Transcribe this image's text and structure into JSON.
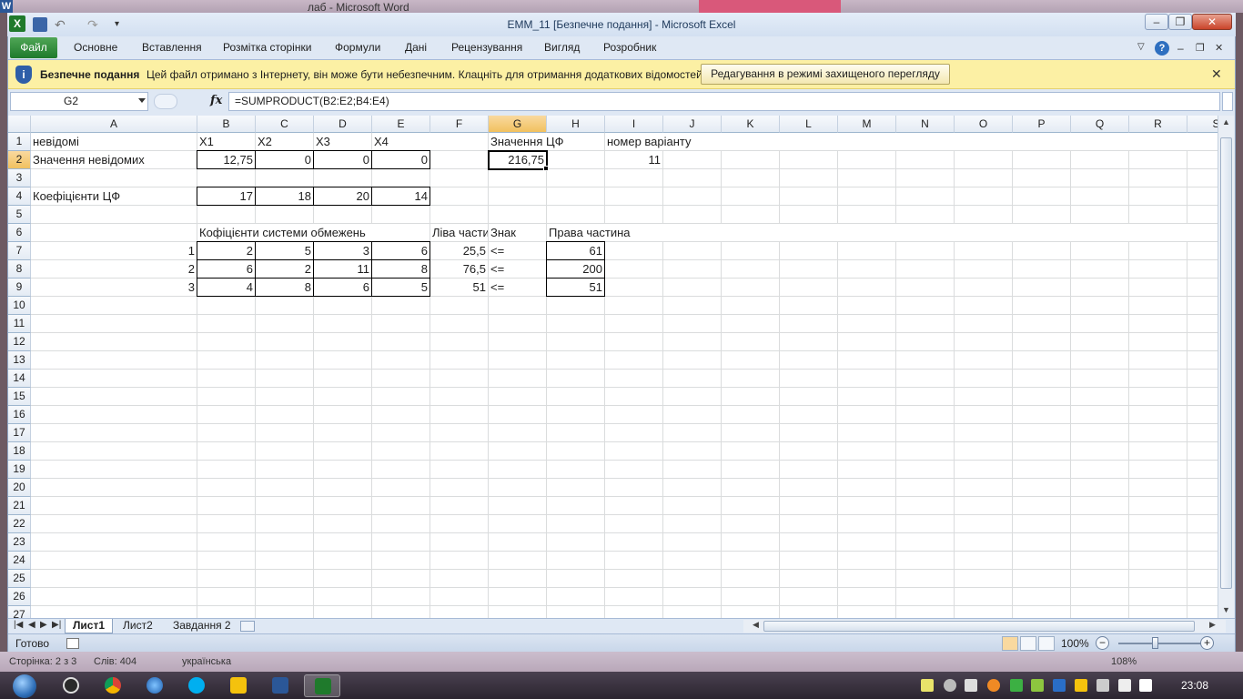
{
  "background_window": {
    "word_title": "лаб  -  Microsoft Word",
    "word_icon_letter": "W",
    "status": {
      "page": "Сторінка: 2 з 3",
      "words": "Слів: 404",
      "language": "українська",
      "zoom": "108%"
    }
  },
  "window": {
    "title": "ЕММ_11  [Безпечне подання]  -  Microsoft Excel",
    "app_icon_letter": "X"
  },
  "ribbon": {
    "file_tab": "Файл",
    "tabs": [
      "Основне",
      "Вставлення",
      "Розмітка сторінки",
      "Формули",
      "Дані",
      "Рецензування",
      "Вигляд",
      "Розробник"
    ]
  },
  "protected_view": {
    "title": "Безпечне подання",
    "message": "Цей файл отримано з Інтернету, він може бути небезпечним. Клацніть для отримання додаткових відомостей.",
    "button_label": "Редагування в режимі захищеного перегляду"
  },
  "formula_bar": {
    "name_box": "G2",
    "fx_label": "fx",
    "formula": "=SUMPRODUCT(B2:E2;B4:E4)"
  },
  "grid": {
    "columns": [
      "A",
      "B",
      "C",
      "D",
      "E",
      "F",
      "G",
      "H",
      "I",
      "J",
      "K",
      "L",
      "M",
      "N",
      "O",
      "P",
      "Q",
      "R",
      "S"
    ],
    "rows": [
      "1",
      "2",
      "3",
      "4",
      "5",
      "6",
      "7",
      "8",
      "9",
      "10",
      "11",
      "12",
      "13",
      "14",
      "15",
      "16",
      "17",
      "18",
      "19",
      "20",
      "21",
      "22",
      "23",
      "24",
      "25",
      "26",
      "27"
    ],
    "cells": [
      [
        "A1",
        "невідомі"
      ],
      [
        "B1",
        "X1"
      ],
      [
        "C1",
        "X2"
      ],
      [
        "D1",
        "X3"
      ],
      [
        "E1",
        "X4"
      ],
      [
        "G1",
        "Значення ЦФ"
      ],
      [
        "I1",
        "номер варіанту"
      ],
      [
        "A2",
        "Значення невідомих"
      ],
      [
        "B2",
        "12,75"
      ],
      [
        "C2",
        "0"
      ],
      [
        "D2",
        "0"
      ],
      [
        "E2",
        "0"
      ],
      [
        "G2",
        "216,75"
      ],
      [
        "I2",
        "11"
      ],
      [
        "A4",
        "Коефіцієнти ЦФ"
      ],
      [
        "B4",
        "17"
      ],
      [
        "C4",
        "18"
      ],
      [
        "D4",
        "20"
      ],
      [
        "E4",
        "14"
      ],
      [
        "B6",
        "Кофіцієнти системи обмежень"
      ],
      [
        "F6",
        "Ліва частина"
      ],
      [
        "G6",
        "Знак"
      ],
      [
        "H6",
        "Права частина"
      ],
      [
        "A7",
        "1"
      ],
      [
        "B7",
        "2"
      ],
      [
        "C7",
        "5"
      ],
      [
        "D7",
        "3"
      ],
      [
        "E7",
        "6"
      ],
      [
        "F7",
        "25,5"
      ],
      [
        "G7",
        "<="
      ],
      [
        "H7",
        "61"
      ],
      [
        "A8",
        "2"
      ],
      [
        "B8",
        "6"
      ],
      [
        "C8",
        "2"
      ],
      [
        "D8",
        "11"
      ],
      [
        "E8",
        "8"
      ],
      [
        "F8",
        "76,5"
      ],
      [
        "G8",
        "<="
      ],
      [
        "H8",
        "200"
      ],
      [
        "A9",
        "3"
      ],
      [
        "B9",
        "4"
      ],
      [
        "C9",
        "8"
      ],
      [
        "D9",
        "6"
      ],
      [
        "E9",
        "5"
      ],
      [
        "F9",
        "51"
      ],
      [
        "G9",
        "<="
      ],
      [
        "H9",
        "51"
      ]
    ]
  },
  "sheets": {
    "tabs": [
      "Лист1",
      "Лист2",
      "Завдання 2"
    ],
    "active": "Лист1"
  },
  "status_bar": {
    "ready": "Готово",
    "zoom": "100%",
    "zoom_out": "−",
    "zoom_in": "+"
  },
  "taskbar": {
    "clock": "23:08"
  },
  "colors": {
    "selected_header": "#f1c15f",
    "file_tab": "#1f7a2c",
    "protected_bar": "#fcf0a4"
  }
}
